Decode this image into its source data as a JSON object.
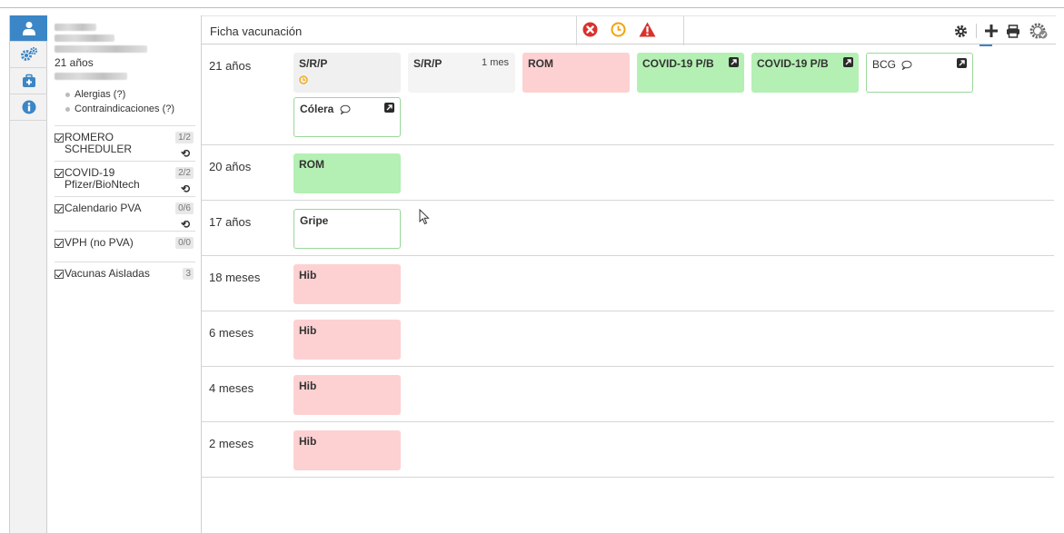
{
  "rail": {
    "items": [
      {
        "name": "patient"
      },
      {
        "name": "settings"
      },
      {
        "name": "medical-kit"
      },
      {
        "name": "info"
      }
    ]
  },
  "patient": {
    "age": "21 años",
    "allergies_label": "Alergias (?)",
    "contraindications_label": "Contraindicaciones (?)"
  },
  "schedules": [
    {
      "label": "ROMERO SCHEDULER",
      "count": "1/2",
      "undo": true
    },
    {
      "label": "COVID-19 Pfizer/BioNtech",
      "count": "2/2",
      "undo": true
    },
    {
      "label": "Calendario PVA",
      "count": "0/6",
      "undo": true
    },
    {
      "label": "VPH (no PVA)",
      "count": "0/0",
      "undo": false
    },
    {
      "label": "Vacunas Aisladas",
      "count": "3",
      "undo": false
    }
  ],
  "header": {
    "title": "Ficha vacunación"
  },
  "rows": [
    {
      "age": "21 años",
      "cards": [
        {
          "label": "S/R/P",
          "style": "grey",
          "clock": true
        },
        {
          "label": "S/R/P",
          "sub": "1 mes",
          "style": "grey"
        },
        {
          "label": "ROM",
          "style": "red"
        },
        {
          "label": "COVID-19 P/B",
          "style": "green",
          "ext": true
        },
        {
          "label": "COVID-19 P/B",
          "style": "green",
          "ext": true
        },
        {
          "label": "BCG",
          "style": "outline",
          "ext": true,
          "comment": true
        },
        {
          "label": "Cólera",
          "style": "outline",
          "ext": true,
          "comment": true
        }
      ]
    },
    {
      "age": "20 años",
      "cards": [
        {
          "label": "ROM",
          "style": "green"
        }
      ]
    },
    {
      "age": "17 años",
      "cards": [
        {
          "label": "Gripe",
          "style": "outline"
        }
      ]
    },
    {
      "age": "18 meses",
      "cards": [
        {
          "label": "Hib",
          "style": "red"
        }
      ]
    },
    {
      "age": "6 meses",
      "cards": [
        {
          "label": "Hib",
          "style": "red"
        }
      ]
    },
    {
      "age": "4 meses",
      "cards": [
        {
          "label": "Hib",
          "style": "red"
        }
      ]
    },
    {
      "age": "2 meses",
      "cards": [
        {
          "label": "Hib",
          "style": "red"
        }
      ]
    }
  ],
  "colors": {
    "accent": "#3b86c6",
    "card_red": "#fdd1d2",
    "card_green": "#b4f0b3",
    "card_grey": "#f0f0f0",
    "alert_red": "#d9312c",
    "alert_orange": "#f3a20b"
  }
}
